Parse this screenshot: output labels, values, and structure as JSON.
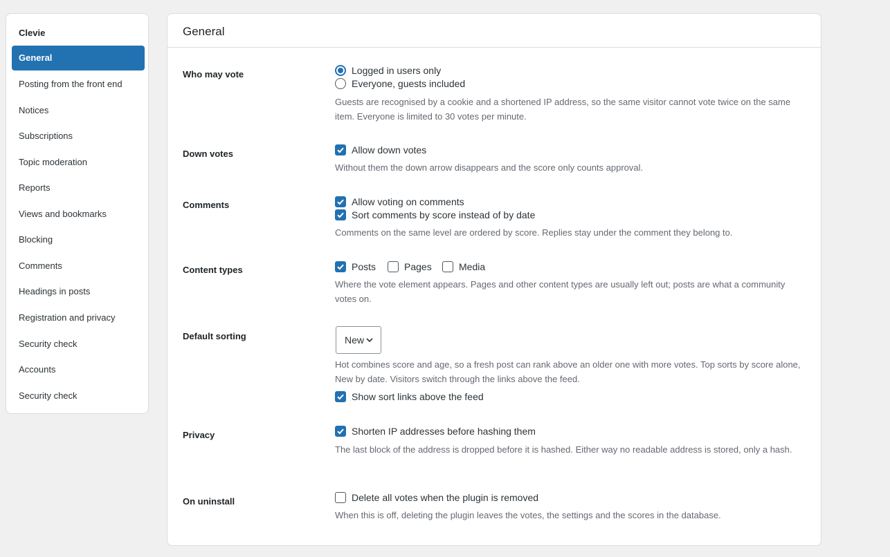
{
  "sidebar": {
    "brand": "Clevie",
    "items": [
      {
        "label": "General",
        "active": true
      },
      {
        "label": "Posting from the front end"
      },
      {
        "label": "Notices"
      },
      {
        "label": "Subscriptions"
      },
      {
        "label": "Topic moderation"
      },
      {
        "label": "Reports"
      },
      {
        "label": "Views and bookmarks"
      },
      {
        "label": "Blocking"
      },
      {
        "label": "Comments"
      },
      {
        "label": "Headings in posts"
      },
      {
        "label": "Registration and privacy"
      },
      {
        "label": "Security check"
      },
      {
        "label": "Accounts"
      },
      {
        "label": "Security check"
      }
    ]
  },
  "panel": {
    "title": "General",
    "who_may_vote": {
      "label": "Who may vote",
      "options": [
        {
          "label": "Logged in users only",
          "selected": true
        },
        {
          "label": "Everyone, guests included",
          "selected": false
        }
      ],
      "description": "Guests are recognised by a cookie and a shortened IP address, so the same visitor cannot vote twice on the same item. Everyone is limited to 30 votes per minute."
    },
    "down_votes": {
      "label": "Down votes",
      "checkbox": {
        "label": "Allow down votes",
        "checked": true
      },
      "description": "Without them the down arrow disappears and the score only counts approval."
    },
    "comments": {
      "label": "Comments",
      "checkboxes": [
        {
          "label": "Allow voting on comments",
          "checked": true
        },
        {
          "label": "Sort comments by score instead of by date",
          "checked": true
        }
      ],
      "description": "Comments on the same level are ordered by score. Replies stay under the comment they belong to."
    },
    "content_types": {
      "label": "Content types",
      "checkboxes": [
        {
          "label": "Posts",
          "checked": true
        },
        {
          "label": "Pages",
          "checked": false
        },
        {
          "label": "Media",
          "checked": false
        }
      ],
      "description": "Where the vote element appears. Pages and other content types are usually left out; posts are what a community votes on."
    },
    "default_sorting": {
      "label": "Default sorting",
      "select_value": "New",
      "description": "Hot combines score and age, so a fresh post can rank above an older one with more votes. Top sorts by score alone, New by date. Visitors switch through the links above the feed.",
      "checkbox": {
        "label": "Show sort links above the feed",
        "checked": true
      }
    },
    "privacy": {
      "label": "Privacy",
      "checkbox": {
        "label": "Shorten IP addresses before hashing them",
        "checked": true
      },
      "description": "The last block of the address is dropped before it is hashed. Either way no readable address is stored, only a hash."
    },
    "on_uninstall": {
      "label": "On uninstall",
      "checkbox": {
        "label": "Delete all votes when the plugin is removed",
        "checked": false
      },
      "description": "When this is off, deleting the plugin leaves the votes, the settings and the scores in the database."
    }
  },
  "colors": {
    "accent": "#2271b1",
    "page_background": "#f0f0f1",
    "description_text": "#646970"
  }
}
